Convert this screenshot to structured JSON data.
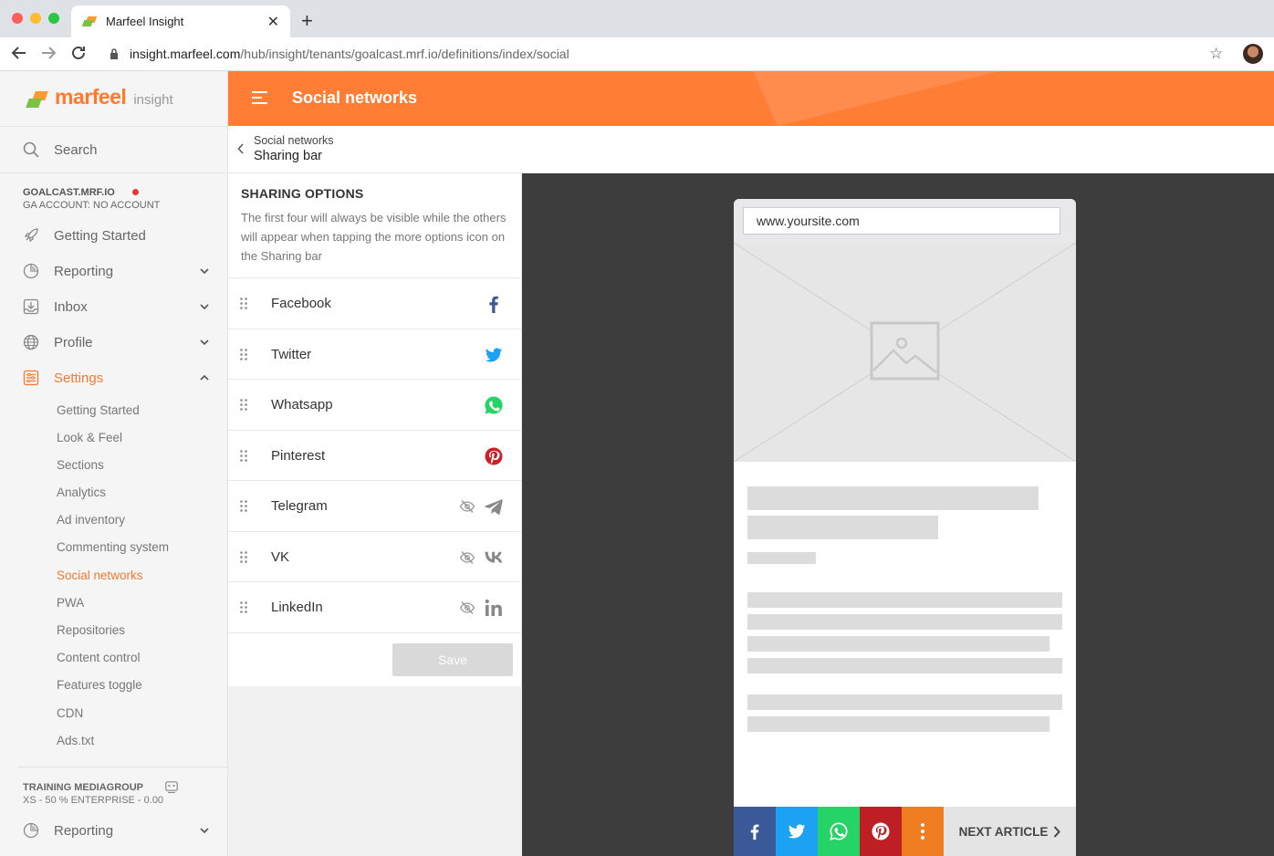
{
  "browser": {
    "tab_title": "Marfeel Insight",
    "url_host": "insight.marfeel.com",
    "url_path": "/hub/insight/tenants/goalcast.mrf.io/definitions/index/social"
  },
  "sidebar": {
    "logo_brand": "marfeel",
    "logo_product": "insight",
    "search_label": "Search",
    "tenant_name": "GOALCAST.MRF.IO",
    "tenant_account": "GA ACCOUNT: NO ACCOUNT",
    "nav": {
      "getting_started": "Getting Started",
      "reporting": "Reporting",
      "inbox": "Inbox",
      "profile": "Profile",
      "settings": "Settings"
    },
    "settings_items": [
      "Getting Started",
      "Look & Feel",
      "Sections",
      "Analytics",
      "Ad inventory",
      "Commenting system",
      "Social networks",
      "PWA",
      "Repositories",
      "Content control",
      "Features toggle",
      "CDN",
      "Ads.txt"
    ],
    "org_name": "TRAINING MEDIAGROUP",
    "org_plan": "XS - 50 % ENTERPRISE - 0.00",
    "org_reporting": "Reporting"
  },
  "header": {
    "title": "Social networks"
  },
  "breadcrumb": {
    "parent": "Social networks",
    "current": "Sharing bar"
  },
  "sharing_options": {
    "heading": "SHARING OPTIONS",
    "description": "The first four will always be visible while the others will appear when tapping the more options icon on the Sharing bar",
    "networks": [
      {
        "label": "Facebook",
        "icon": "facebook-icon",
        "visible": true,
        "color": "#3b5998"
      },
      {
        "label": "Twitter",
        "icon": "twitter-icon",
        "visible": true,
        "color": "#1da1f2"
      },
      {
        "label": "Whatsapp",
        "icon": "whatsapp-icon",
        "visible": true,
        "color": "#25d366"
      },
      {
        "label": "Pinterest",
        "icon": "pinterest-icon",
        "visible": true,
        "color": "#cb2027"
      },
      {
        "label": "Telegram",
        "icon": "telegram-icon",
        "visible": false,
        "color": "#888888"
      },
      {
        "label": "VK",
        "icon": "vk-icon",
        "visible": false,
        "color": "#888888"
      },
      {
        "label": "LinkedIn",
        "icon": "linkedin-icon",
        "visible": false,
        "color": "#888888"
      }
    ],
    "save_label": "Save"
  },
  "preview": {
    "url": "www.yoursite.com",
    "next_article": "NEXT ARTICLE",
    "share_colors": {
      "facebook": "#3b5998",
      "twitter": "#1da1f2",
      "whatsapp": "#25d366",
      "pinterest": "#bd1f25",
      "more": "#f07d22"
    }
  },
  "colors": {
    "accent": "#ff7d35",
    "active_nav": "#f47a30"
  }
}
